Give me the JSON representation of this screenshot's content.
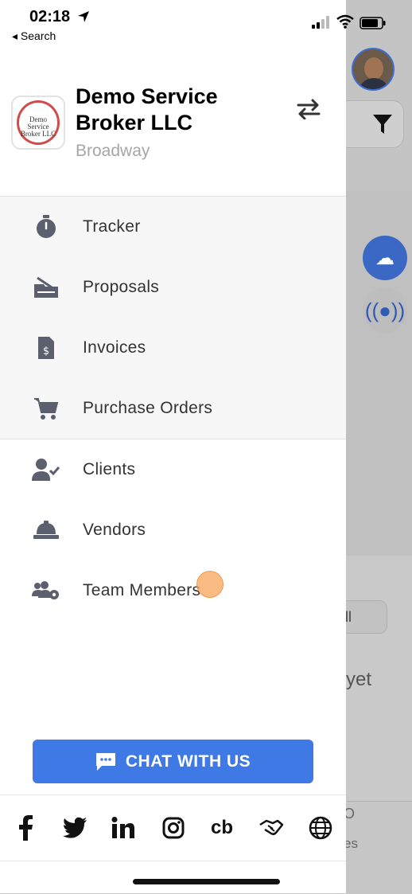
{
  "status_bar": {
    "time": "02:18",
    "back_label": "◂ Search"
  },
  "drawer": {
    "company": {
      "name": "Demo Service Broker LLC",
      "location": "Broadway",
      "logo_text": "Demo Service Broker LLC"
    },
    "primary_menu": [
      {
        "label": "Tracker",
        "icon": "stopwatch-icon"
      },
      {
        "label": "Proposals",
        "icon": "proposal-icon"
      },
      {
        "label": "Invoices",
        "icon": "invoice-icon"
      },
      {
        "label": "Purchase Orders",
        "icon": "cart-icon"
      }
    ],
    "secondary_menu": [
      {
        "label": "Clients",
        "icon": "client-check-icon"
      },
      {
        "label": "Vendors",
        "icon": "hard-hat-icon"
      },
      {
        "label": "Team Members",
        "icon": "team-gear-icon"
      }
    ],
    "chat_button": {
      "label": "CHAT WITH US",
      "icon": "chat-bubble-icon"
    },
    "social": [
      {
        "name": "facebook-icon",
        "glyph": "f"
      },
      {
        "name": "twitter-icon",
        "glyph": ""
      },
      {
        "name": "linkedin-icon",
        "glyph": "in"
      },
      {
        "name": "instagram-icon",
        "glyph": ""
      },
      {
        "name": "cb-icon",
        "glyph": "cb"
      },
      {
        "name": "handshake-icon",
        "glyph": ""
      },
      {
        "name": "globe-icon",
        "glyph": ""
      }
    ]
  },
  "background": {
    "button_fragment": "ll",
    "text_fragment": "yet",
    "bottom_fragment_1": "O",
    "bottom_fragment_2": "es"
  },
  "colors": {
    "accent": "#3e79e5",
    "text": "#333333",
    "muted": "#a6a6a6",
    "divider": "#e3e3e3"
  }
}
